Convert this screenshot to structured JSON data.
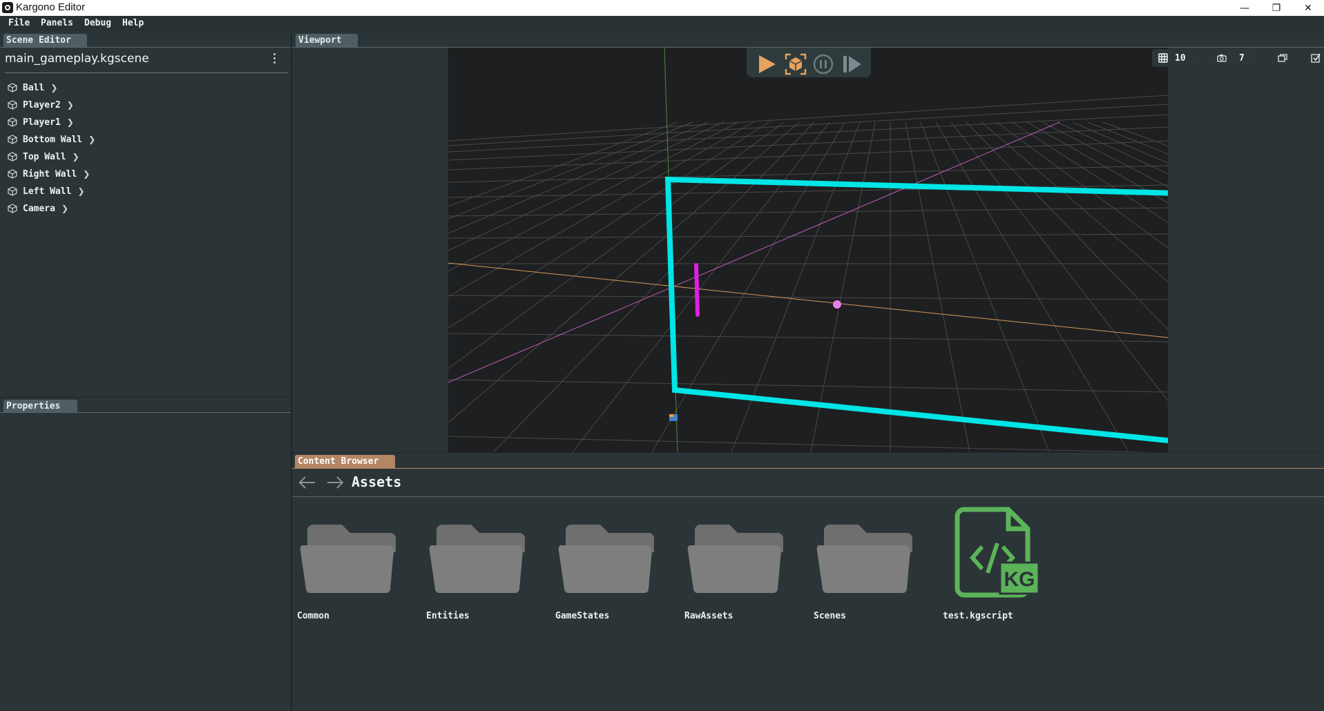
{
  "window": {
    "title": "Kargono Editor",
    "controls": [
      "minimize-icon",
      "restore-icon",
      "close-icon"
    ]
  },
  "menu": [
    "File",
    "Panels",
    "Debug",
    "Help"
  ],
  "scene_editor": {
    "tab": "Scene Editor",
    "scene_name": "main_gameplay.kgscene",
    "entities": [
      "Ball",
      "Player2",
      "Player1",
      "Bottom Wall",
      "Top Wall",
      "Right Wall",
      "Left Wall",
      "Camera"
    ]
  },
  "properties": {
    "tab": "Properties"
  },
  "viewport": {
    "tab": "Viewport",
    "controls": [
      "play-icon",
      "simulate-icon",
      "pause-icon",
      "step-icon"
    ],
    "grid_value": "10",
    "camera_value": "7",
    "colors": {
      "frame": "#00e5e5",
      "paddles": "#e020e0",
      "grid": "#4a4a4a",
      "axis_x": "#d79a5a",
      "axis_z": "#c060c0",
      "axis_y": "#4f8a3a"
    }
  },
  "content_browser": {
    "tab": "Content Browser",
    "path": "Assets",
    "items": [
      {
        "name": "Common",
        "icon": "folder-icon"
      },
      {
        "name": "Entities",
        "icon": "folder-icon"
      },
      {
        "name": "GameStates",
        "icon": "folder-icon"
      },
      {
        "name": "RawAssets",
        "icon": "folder-icon"
      },
      {
        "name": "Scenes",
        "icon": "folder-icon"
      },
      {
        "name": "test.kgscript",
        "icon": "kgscript-file-icon"
      }
    ]
  }
}
